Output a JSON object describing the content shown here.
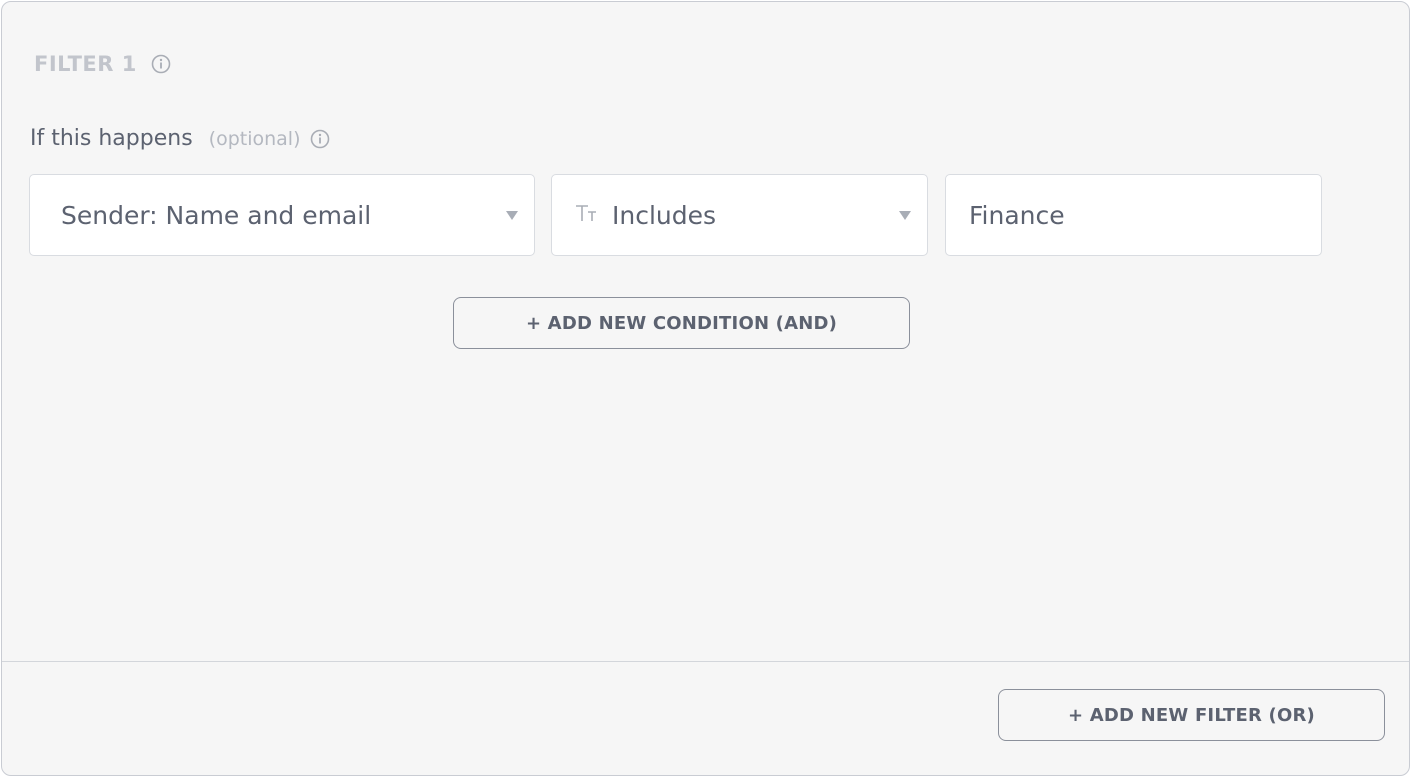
{
  "filter": {
    "title": "FILTER 1",
    "info_icon": "info-icon"
  },
  "condition_section": {
    "label": "If this happens",
    "optional": "(optional)",
    "info_icon": "info-icon"
  },
  "condition_row": {
    "field": {
      "value": "Sender: Name and email",
      "icon": "chevron-down-icon"
    },
    "operator": {
      "icon": "text-type-icon",
      "value": "Includes",
      "caret_icon": "chevron-down-icon"
    },
    "value_input": {
      "value": "Finance"
    }
  },
  "buttons": {
    "add_condition": "+ ADD NEW CONDITION (AND)",
    "add_filter": "+ ADD NEW FILTER (OR)"
  },
  "colors": {
    "panel_bg": "#f6f6f6",
    "text_primary": "#5c6270",
    "text_muted": "#c2c5cc",
    "border": "#d9dce1"
  }
}
